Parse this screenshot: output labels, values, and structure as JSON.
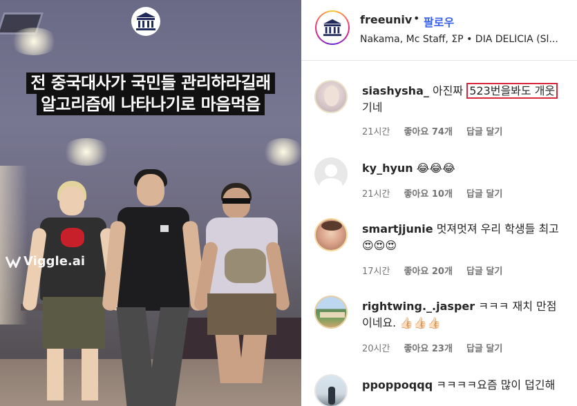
{
  "video": {
    "caption_line1": "전 중국대사가 국민들 관리하라길래",
    "caption_line2": "알고리즘에 나타나기로 마음먹음",
    "watermark": "Viggle.ai"
  },
  "header": {
    "username": "freeuniv",
    "separator": "•",
    "follow_label": "팔로우",
    "subtitle": "Nakama, Mc Staff, ΣP • DIA DELÍCIA (Sl..."
  },
  "comments": [
    {
      "username": "siashysha_",
      "text_before": " 아진짜 ",
      "highlight": "523번을봐도 개웃",
      "text_after": "기네",
      "time": "21시간",
      "likes": "좋아요 74개",
      "reply": "답글 달기"
    },
    {
      "username": "ky_hyun",
      "text": " 😂😂😂",
      "time": "21시간",
      "likes": "좋아요 10개",
      "reply": "답글 달기"
    },
    {
      "username": "smartjjunie",
      "text": " 멋져멋져 우리 학생들 최고😍😍😍",
      "time": "17시간",
      "likes": "좋아요 20개",
      "reply": "답글 달기"
    },
    {
      "username": "rightwing._.jasper",
      "text": " ㅋㅋㅋ 재치 만점이네요. 👍🏻👍🏻👍🏻",
      "time": "20시간",
      "likes": "좋아요 23개",
      "reply": "답글 달기"
    },
    {
      "username": "ppoppoqqq",
      "text": " ㅋㅋㅋㅋ요즘 많이 덥긴해",
      "time": "",
      "likes": "",
      "reply": ""
    }
  ],
  "colors": {
    "follow_blue": "#3a60e8",
    "highlight_red": "#d9263b",
    "meta_gray": "#737373"
  }
}
